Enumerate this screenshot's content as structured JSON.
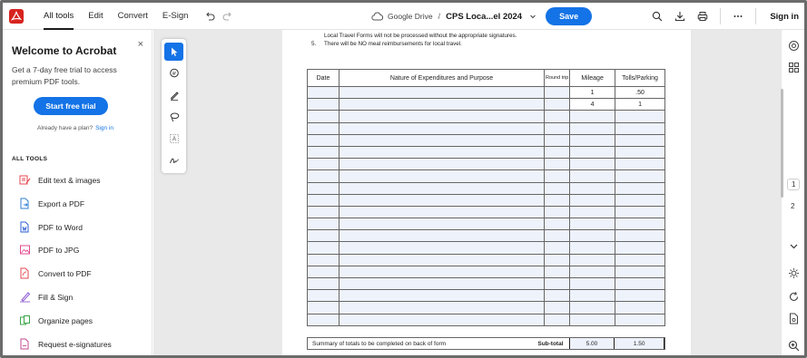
{
  "menu": {
    "all_tools": "All tools",
    "edit": "Edit",
    "convert": "Convert",
    "esign": "E-Sign"
  },
  "doc": {
    "location": "Google Drive",
    "separator": "/",
    "title": "CPS Loca...el 2024",
    "save": "Save"
  },
  "topright": {
    "signin": "Sign in"
  },
  "panel": {
    "close": "×",
    "title": "Welcome to Acrobat",
    "desc": "Get a 7-day free trial to access premium PDF tools.",
    "trial_button": "Start free trial",
    "have_plan": "Already have a plan?",
    "signin_link": "Sign in",
    "section": "ALL TOOLS",
    "tools": [
      {
        "label": "Edit text & images",
        "icon": "edit-text-icon",
        "color": "#e34850"
      },
      {
        "label": "Export a PDF",
        "icon": "export-pdf-icon",
        "color": "#2d7fd3"
      },
      {
        "label": "PDF to Word",
        "icon": "pdf-to-word-icon",
        "color": "#2d5fd3"
      },
      {
        "label": "PDF to JPG",
        "icon": "pdf-to-jpg-icon",
        "color": "#e34890"
      },
      {
        "label": "Convert to PDF",
        "icon": "convert-pdf-icon",
        "color": "#e34850"
      },
      {
        "label": "Fill & Sign",
        "icon": "fill-sign-icon",
        "color": "#8c5ad3"
      },
      {
        "label": "Organize pages",
        "icon": "organize-pages-icon",
        "color": "#3aa54a"
      },
      {
        "label": "Request e-signatures",
        "icon": "request-esign-icon",
        "color": "#c34890"
      }
    ]
  },
  "notes": [
    {
      "num": "",
      "text": "Local Travel Forms will not be processed without the appropriate signatures."
    },
    {
      "num": "5.",
      "text": "There will be NO meal reimbursements for local travel."
    }
  ],
  "table": {
    "headers": [
      "Date",
      "Nature of Expenditures and Purpose",
      "Round trip",
      "Mileage",
      "Tolls/Parking"
    ],
    "rows": [
      [
        "",
        "",
        "",
        "1",
        ".50"
      ],
      [
        "",
        "",
        "",
        "4",
        "1"
      ]
    ],
    "summary_label": "Summary of totals to be completed on back of form",
    "subtotal_label": "Sub-total",
    "subtotal_mileage": "5.00",
    "subtotal_tolls": "1.50"
  },
  "pages": {
    "current": "1",
    "next": "2"
  },
  "accent": "#1473e6"
}
